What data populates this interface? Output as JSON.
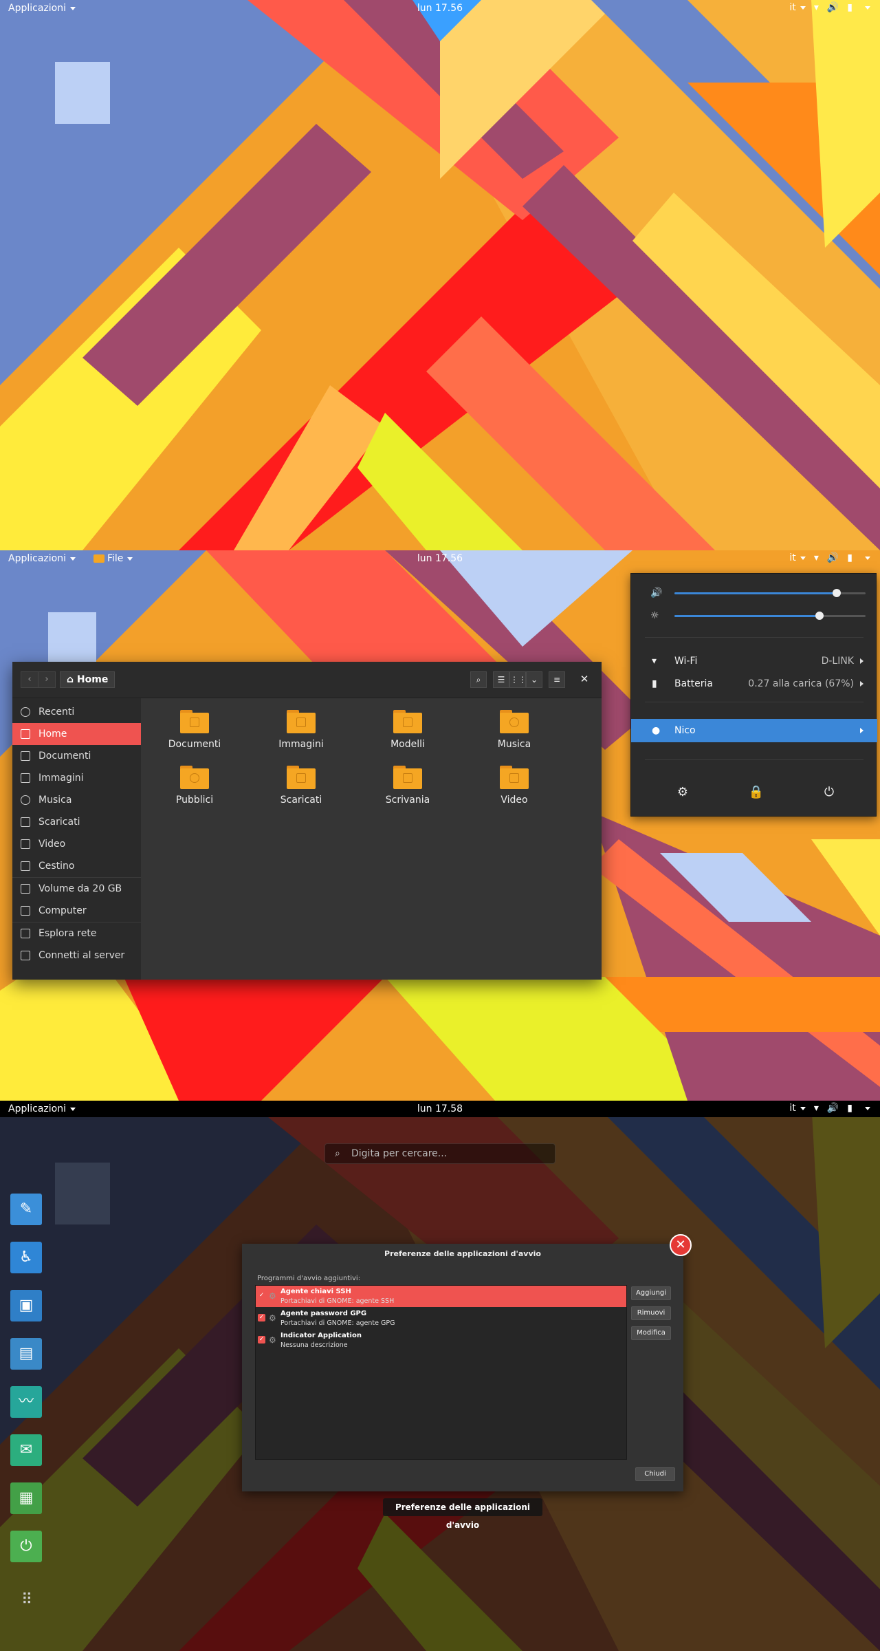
{
  "colors": {
    "accent": "#ef5350",
    "selection_blue": "#3b87d8",
    "folder": "#f5a623",
    "panel_dark": "#2b2b2b"
  },
  "screen1": {
    "topbar": {
      "activities": "Applicazioni",
      "clock": "lun 17.56",
      "lang": "it",
      "icons": [
        "wifi-icon",
        "volume-icon",
        "battery-icon"
      ]
    }
  },
  "screen2": {
    "topbar": {
      "activities": "Applicazioni",
      "app_menu": "File",
      "clock": "lun 17.56",
      "lang": "it"
    },
    "nautilus": {
      "path_button": "Home",
      "sidebar": [
        {
          "label": "Recenti",
          "icon": "clock-icon"
        },
        {
          "label": "Home",
          "icon": "home-icon",
          "active": true
        },
        {
          "label": "Documenti",
          "icon": "document-icon"
        },
        {
          "label": "Immagini",
          "icon": "image-icon"
        },
        {
          "label": "Musica",
          "icon": "music-icon"
        },
        {
          "label": "Scaricati",
          "icon": "download-icon"
        },
        {
          "label": "Video",
          "icon": "video-icon"
        },
        {
          "label": "Cestino",
          "icon": "trash-icon"
        },
        {
          "label": "Volume da 20 GB",
          "icon": "drive-icon"
        },
        {
          "label": "Computer",
          "icon": "computer-icon"
        },
        {
          "label": "Esplora rete",
          "icon": "network-icon"
        },
        {
          "label": "Connetti al server",
          "icon": "server-icon"
        }
      ],
      "folders": [
        {
          "label": "Documenti",
          "icon": "folder-documents-icon"
        },
        {
          "label": "Immagini",
          "icon": "folder-pictures-icon"
        },
        {
          "label": "Modelli",
          "icon": "folder-templates-icon"
        },
        {
          "label": "Musica",
          "icon": "folder-music-icon"
        },
        {
          "label": "Pubblici",
          "icon": "folder-public-icon"
        },
        {
          "label": "Scaricati",
          "icon": "folder-download-icon"
        },
        {
          "label": "Scrivania",
          "icon": "folder-desktop-icon"
        },
        {
          "label": "Video",
          "icon": "folder-videos-icon"
        }
      ]
    },
    "system_menu": {
      "volume_level": 0.85,
      "brightness_level": 0.76,
      "wifi_label": "Wi-Fi",
      "wifi_value": "D-LINK",
      "battery_label": "Batteria",
      "battery_value": "0.27 alla carica (67%)",
      "user": "Nico"
    }
  },
  "screen3": {
    "topbar": {
      "activities": "Applicazioni",
      "clock": "lun 17.58",
      "lang": "it"
    },
    "search_placeholder": "Digita per cercare...",
    "dock": [
      {
        "icon": "text-editor-icon",
        "color": "#3b8fd9"
      },
      {
        "icon": "accessibility-icon",
        "color": "#2f86d6"
      },
      {
        "icon": "package-icon",
        "color": "#2f7fc7"
      },
      {
        "icon": "document-viewer-icon",
        "color": "#3a89c7"
      },
      {
        "icon": "system-monitor-icon",
        "color": "#26a69a"
      },
      {
        "icon": "chat-icon",
        "color": "#2cae7e"
      },
      {
        "icon": "spreadsheet-icon",
        "color": "#43a047"
      },
      {
        "icon": "power-icon",
        "color": "#4caf50"
      }
    ],
    "dialog": {
      "title": "Preferenze delle applicazioni d'avvio",
      "subtitle": "Programmi d'avvio aggiuntivi:",
      "items": [
        {
          "name": "Agente chiavi SSH",
          "desc": "Portachiavi di GNOME: agente SSH",
          "checked": true,
          "selected": true
        },
        {
          "name": "Agente password GPG",
          "desc": "Portachiavi di GNOME: agente GPG",
          "checked": true,
          "selected": false
        },
        {
          "name": "Indicator Application",
          "desc": "Nessuna descrizione",
          "checked": true,
          "selected": false
        }
      ],
      "buttons": {
        "add": "Aggiungi",
        "remove": "Rimuovi",
        "edit": "Modifica",
        "close": "Chiudi"
      }
    },
    "tooltip": "Preferenze delle applicazioni d'avvio"
  }
}
